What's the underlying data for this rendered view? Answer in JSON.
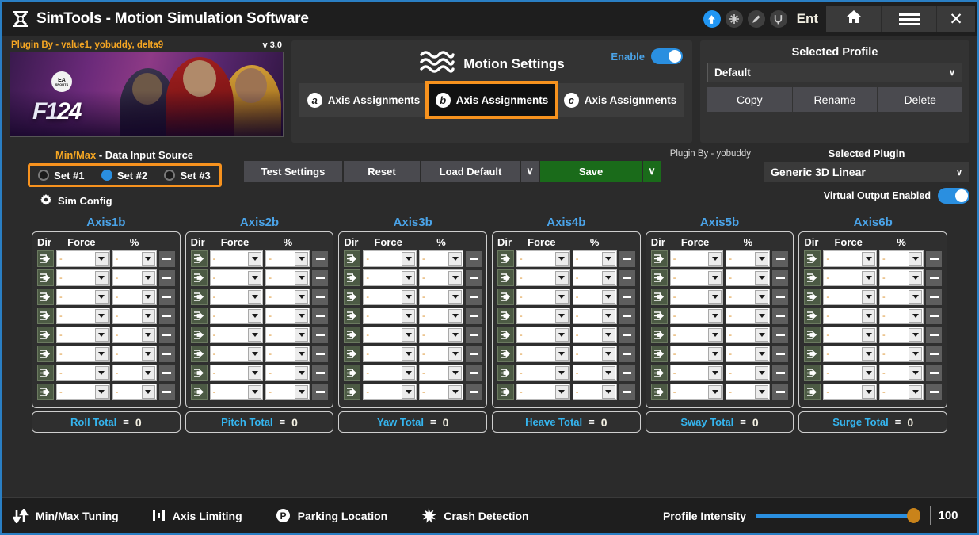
{
  "titlebar": {
    "logo_icon": "simtools-logo-icon",
    "title": "SimTools - Motion Simulation Software",
    "icons": [
      {
        "name": "upload-arrow-icon",
        "glyph": "⬆",
        "active": true
      },
      {
        "name": "burst-icon",
        "glyph": "✳",
        "active": false
      },
      {
        "name": "pencil-icon",
        "glyph": "✎",
        "active": false
      },
      {
        "name": "power-plug-icon",
        "glyph": "⏻",
        "active": false
      }
    ],
    "ent_label": "Ent",
    "home_icon": "home-icon",
    "menu_icon": "hamburger-menu-icon",
    "close_icon": "close-icon"
  },
  "cover": {
    "plugin_by": "Plugin By - value1, yobuddy, delta9",
    "version": "v 3.0",
    "ea_line1": "EA",
    "ea_line2": "SPORTS",
    "game_f1": "F1",
    "game_num": "24"
  },
  "motion_settings": {
    "wave_icon": "wave-icon",
    "title": "Motion Settings",
    "enable_label": "Enable",
    "enable_on": true,
    "tabs": [
      {
        "badge": "a",
        "label": "Axis Assignments",
        "selected": false
      },
      {
        "badge": "b",
        "label": "Axis Assignments",
        "selected": true
      },
      {
        "badge": "c",
        "label": "Axis Assignments",
        "selected": false
      }
    ]
  },
  "profile": {
    "title": "Selected Profile",
    "selected": "Default",
    "chevron": "∨",
    "buttons": [
      "Copy",
      "Rename",
      "Delete"
    ]
  },
  "minmax": {
    "title_orange": "Min/Max",
    "title_white": " - Data Input Source",
    "options": [
      {
        "label": "Set #1",
        "selected": false
      },
      {
        "label": "Set #2",
        "selected": true
      },
      {
        "label": "Set #3",
        "selected": false
      }
    ],
    "sim_config_icon": "gear-icon",
    "sim_config_label": "Sim Config"
  },
  "actions": {
    "plugin_by": "Plugin By - yobuddy",
    "test_settings": "Test Settings",
    "reset": "Reset",
    "load_default": "Load Default",
    "load_default_caret": "∨",
    "save": "Save",
    "save_caret": "∨"
  },
  "plugin": {
    "title": "Selected Plugin",
    "selected": "Generic 3D Linear",
    "chevron": "∨",
    "virtual_output_label": "Virtual Output Enabled",
    "virtual_output_on": true
  },
  "axes": {
    "headers": {
      "dir": "Dir",
      "force": "Force",
      "pct": "%"
    },
    "row_count": 8,
    "empty_value": "-",
    "dir_icon": "direction-arrow-icon",
    "minus_icon": "minus-icon",
    "columns": [
      {
        "title": "Axis1b",
        "total_label": "Roll Total",
        "total_eq": "=",
        "total_value": "0"
      },
      {
        "title": "Axis2b",
        "total_label": "Pitch Total",
        "total_eq": "=",
        "total_value": "0"
      },
      {
        "title": "Axis3b",
        "total_label": "Yaw Total",
        "total_eq": "=",
        "total_value": "0"
      },
      {
        "title": "Axis4b",
        "total_label": "Heave Total",
        "total_eq": "=",
        "total_value": "0"
      },
      {
        "title": "Axis5b",
        "total_label": "Sway Total",
        "total_eq": "=",
        "total_value": "0"
      },
      {
        "title": "Axis6b",
        "total_label": "Surge Total",
        "total_eq": "=",
        "total_value": "0"
      }
    ]
  },
  "bottombar": {
    "items": [
      {
        "icon": "up-down-arrows-icon",
        "label": "Min/Max Tuning"
      },
      {
        "icon": "bar-levels-icon",
        "label": "Axis Limiting"
      },
      {
        "icon": "parking-p-icon",
        "label": "Parking Location"
      },
      {
        "icon": "crash-burst-icon",
        "label": "Crash Detection"
      }
    ],
    "intensity_label": "Profile Intensity",
    "intensity_value": "100"
  },
  "colors": {
    "accent_blue": "#2a8fe0",
    "highlight_orange": "#f7921e",
    "axis_title_blue": "#4aa3e8",
    "total_cyan": "#35b5ef",
    "save_green": "#1a6b1a"
  }
}
